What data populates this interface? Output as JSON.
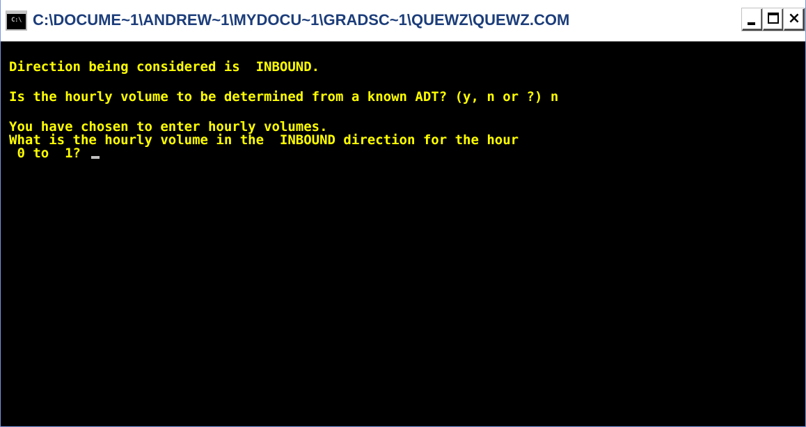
{
  "window": {
    "title": "C:\\DOCUME~1\\ANDREW~1\\MYDOCU~1\\GRADSC~1\\QUEWZ\\QUEWZ.COM",
    "icon": "command-prompt-icon",
    "icon_text": "C:\\",
    "controls": {
      "minimize": "minimize-icon",
      "maximize": "maximize-icon",
      "close": "close-icon",
      "close_glyph": "×"
    }
  },
  "console": {
    "text_color": "#ffff00",
    "background_color": "#000000",
    "lines": [
      "Direction being considered is  INBOUND.",
      "Is the hourly volume to be determined from a known ADT? (y, n or ?) n",
      "You have chosen to enter hourly volumes.",
      "What is the hourly volume in the  INBOUND direction for the hour",
      " 0 to  1? "
    ]
  }
}
